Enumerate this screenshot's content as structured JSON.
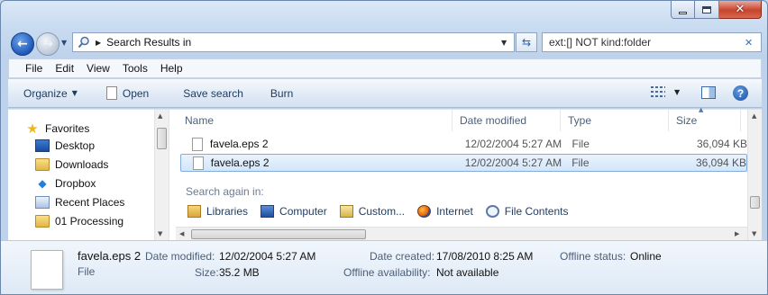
{
  "address": {
    "path": "Search Results in"
  },
  "search": {
    "query": "ext:[] NOT kind:folder"
  },
  "menu": [
    "File",
    "Edit",
    "View",
    "Tools",
    "Help"
  ],
  "toolbar": {
    "organize": "Organize",
    "open": "Open",
    "save_search": "Save search",
    "burn": "Burn"
  },
  "navigation": {
    "favorites": "Favorites",
    "items": [
      "Desktop",
      "Downloads",
      "Dropbox",
      "Recent Places",
      "01 Processing"
    ]
  },
  "columns": [
    "Name",
    "Date modified",
    "Type",
    "Size"
  ],
  "files": [
    {
      "name": "favela.eps 2",
      "date": "12/02/2004 5:27 AM",
      "type": "File",
      "size": "36,094 KB",
      "selected": false
    },
    {
      "name": "favela.eps 2",
      "date": "12/02/2004 5:27 AM",
      "type": "File",
      "size": "36,094 KB",
      "selected": true
    }
  ],
  "search_again": {
    "label": "Search again in:",
    "options": [
      "Libraries",
      "Computer",
      "Custom...",
      "Internet",
      "File Contents"
    ]
  },
  "details": {
    "name": "favela.eps 2",
    "type": "File",
    "date_modified_label": "Date modified:",
    "date_modified": "12/02/2004 5:27 AM",
    "size_label": "Size:",
    "size": "35.2 MB",
    "date_created_label": "Date created:",
    "date_created": "17/08/2010 8:25 AM",
    "offline_availability_label": "Offline availability:",
    "offline_availability": "Not available",
    "offline_status_label": "Offline status:",
    "offline_status": "Online"
  },
  "colors": {
    "selection": "#d2e6fb",
    "selection_border": "#84acdd",
    "close_button": "#c7432c",
    "accent_blue": "#1d58b8"
  }
}
